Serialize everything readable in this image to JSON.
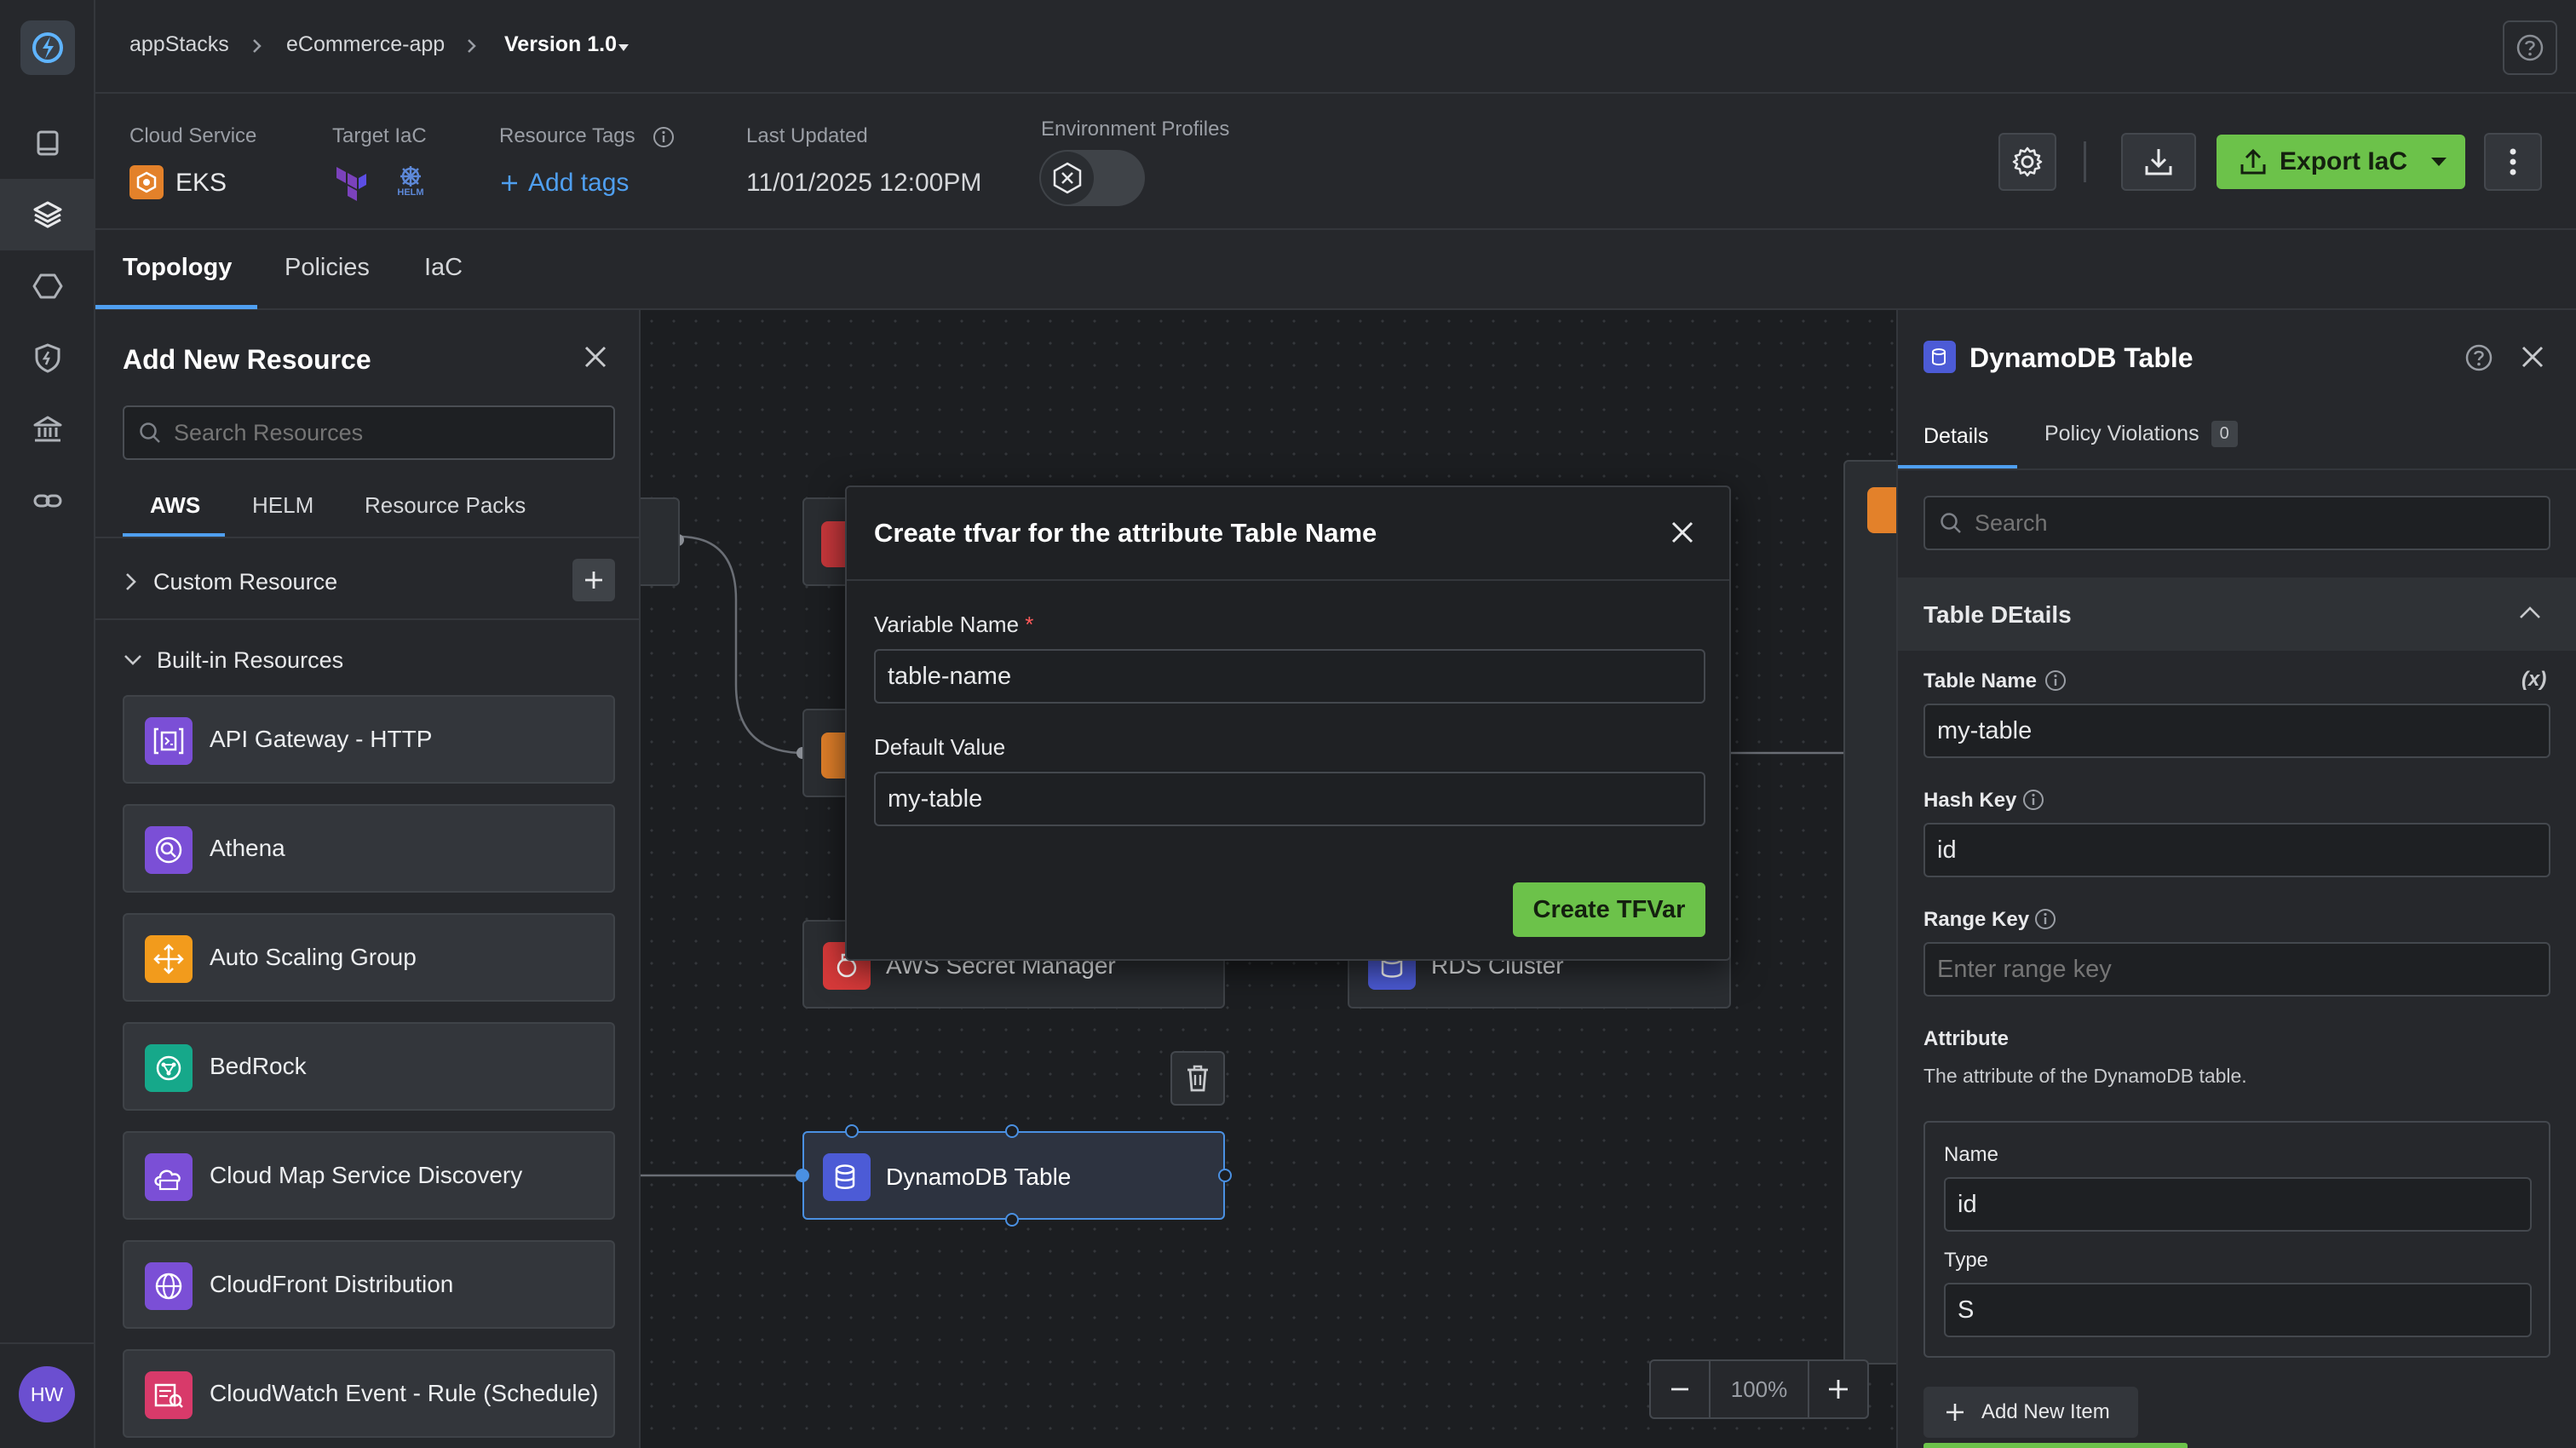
{
  "header": {
    "breadcrumb": [
      "appStacks",
      "eCommerce-app",
      "Version 1.0"
    ]
  },
  "subheader": {
    "cloud_service_label": "Cloud Service",
    "cloud_service_value": "EKS",
    "target_iac_label": "Target IaC",
    "helm_label": "HELM",
    "resource_tags_label": "Resource Tags",
    "add_tags": "Add tags",
    "last_updated_label": "Last Updated",
    "last_updated_value": "11/01/2025 12:00PM",
    "env_profiles_label": "Environment Profiles",
    "export_label": "Export IaC"
  },
  "tabs": [
    "Topology",
    "Policies",
    "IaC"
  ],
  "left_panel": {
    "title": "Add New Resource",
    "search_placeholder": "Search Resources",
    "tabs": [
      "AWS",
      "HELM",
      "Resource Packs"
    ],
    "custom_resource": "Custom Resource",
    "builtin_resources": "Built-in Resources",
    "items": [
      {
        "label": "API Gateway - HTTP",
        "icon": "api-gateway-icon",
        "color": "#7b4fd6"
      },
      {
        "label": "Athena",
        "icon": "athena-icon",
        "color": "#7b4fd6"
      },
      {
        "label": "Auto Scaling Group",
        "icon": "auto-scaling-icon",
        "color": "#f29b1c"
      },
      {
        "label": "BedRock",
        "icon": "bedrock-icon",
        "color": "#16a88a"
      },
      {
        "label": "Cloud Map Service Discovery",
        "icon": "cloud-map-icon",
        "color": "#7b4fd6"
      },
      {
        "label": "CloudFront Distribution",
        "icon": "cloudfront-icon",
        "color": "#7b4fd6"
      },
      {
        "label": "CloudWatch Event - Rule (Schedule)",
        "icon": "cloudwatch-icon",
        "color": "#d83a6a"
      }
    ]
  },
  "canvas": {
    "nodes": {
      "secret_manager": "AWS Secret Manager",
      "rds_cluster": "RDS Cluster",
      "dynamodb": "DynamoDB Table"
    },
    "zoom": "100%"
  },
  "modal": {
    "title": "Create tfvar for the attribute Table Name",
    "variable_name_label": "Variable Name",
    "required_mark": "*",
    "variable_name_value": "table-name",
    "default_value_label": "Default Value",
    "default_value": "my-table",
    "submit": "Create TFVar"
  },
  "right_panel": {
    "title": "DynamoDB Table",
    "tabs": {
      "details": "Details",
      "policy_violations": "Policy Violations",
      "violations_count": "0"
    },
    "search_placeholder": "Search",
    "section_title": "Table DEtails",
    "table_name_label": "Table Name",
    "table_name_value": "my-table",
    "tfvar_icon_text": "(x)",
    "hash_key_label": "Hash Key",
    "hash_key_value": "id",
    "range_key_label": "Range Key",
    "range_key_placeholder": "Enter range key",
    "attribute_label": "Attribute",
    "attribute_desc": "The attribute of the DynamoDB table.",
    "attr_name_label": "Name",
    "attr_name_value": "id",
    "attr_type_label": "Type",
    "attr_type_value": "S",
    "add_item": "Add New Item"
  },
  "user": {
    "initials": "HW"
  },
  "colors": {
    "accent_green": "#6cc24a",
    "node_selected": "#4a90e2",
    "background": "#1d1f22"
  }
}
